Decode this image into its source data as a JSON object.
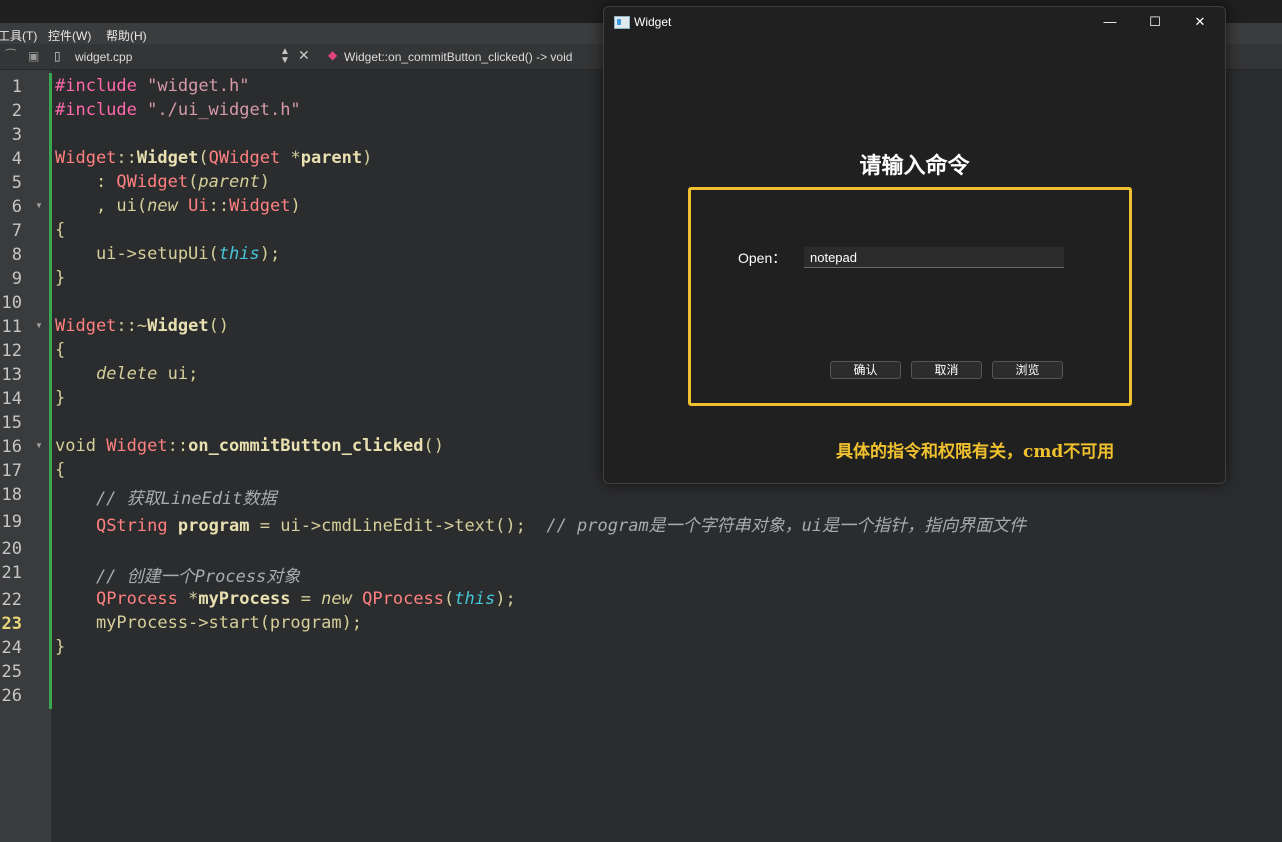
{
  "menubar": {
    "items": [
      "工具(T)",
      "控件(W)",
      "帮助(H)"
    ]
  },
  "tabbar": {
    "filename": "widget.cpp",
    "function_selector": "Widget::on_commitButton_clicked() -> void"
  },
  "editor": {
    "line_numbers": [
      "1",
      "2",
      "3",
      "4",
      "5",
      "6",
      "7",
      "8",
      "9",
      "10",
      "11",
      "12",
      "13",
      "14",
      "15",
      "16",
      "17",
      "18",
      "19",
      "20",
      "21",
      "22",
      "23",
      "24",
      "25",
      "26"
    ],
    "current_line": "23",
    "code": {
      "l1_kw": "#include",
      "l1_str": "\"widget.h\"",
      "l2_kw": "#include",
      "l2_str": "\"./ui_widget.h\"",
      "l4_a": "Widget",
      "l4_b": "::",
      "l4_c": "Widget",
      "l4_d": "(",
      "l4_e": "QWidget",
      "l4_f": " *",
      "l4_g": "parent",
      "l4_h": ")",
      "l5_a": "    : ",
      "l5_b": "QWidget",
      "l5_c": "(",
      "l5_d": "parent",
      "l5_e": ")",
      "l6_a": "    , ui(",
      "l6_b": "new",
      "l6_c": " ",
      "l6_d": "Ui",
      "l6_e": "::",
      "l6_f": "Widget",
      "l6_g": ")",
      "l7": "{",
      "l8_a": "    ui->setupUi(",
      "l8_b": "this",
      "l8_c": ");",
      "l9": "}",
      "l11_a": "Widget",
      "l11_b": "::~",
      "l11_c": "Widget",
      "l11_d": "()",
      "l12": "{",
      "l13_a": "    ",
      "l13_b": "delete",
      "l13_c": " ui;",
      "l14": "}",
      "l16_a": "void ",
      "l16_b": "Widget",
      "l16_c": "::",
      "l16_d": "on_commitButton_clicked",
      "l16_e": "()",
      "l17": "{",
      "l18": "    // 获取LineEdit数据",
      "l19_a": "    ",
      "l19_b": "QString",
      "l19_c": " ",
      "l19_d": "program",
      "l19_e": " = ui->cmdLineEdit->text();  ",
      "l19_f": "// program是一个字符串对象，ui是一个指针，指向界面文件",
      "l21": "    // 创建一个Process对象",
      "l22_a": "    ",
      "l22_b": "QProcess",
      "l22_c": " *",
      "l22_d": "myProcess",
      "l22_e": " = ",
      "l22_f": "new",
      "l22_g": " ",
      "l22_h": "QProcess",
      "l22_i": "(",
      "l22_j": "this",
      "l22_k": ");",
      "l23": "    myProcess->start(program);",
      "l24": "}"
    }
  },
  "dialog": {
    "title": "Widget",
    "heading": "请输入命令",
    "open_label": "Open：",
    "command_value": "notepad",
    "buttons": {
      "confirm": "确认",
      "cancel": "取消",
      "browse": "浏览"
    },
    "note": "具体的指令和权限有关，cmd不可用",
    "controls": {
      "minimize": "—",
      "maximize": "☐",
      "close": "✕"
    }
  },
  "colors": {
    "accent_frame": "#f0c12e",
    "change_marker": "#3aa650",
    "preprocessor": "#ff6aad",
    "type": "#ff8080"
  }
}
